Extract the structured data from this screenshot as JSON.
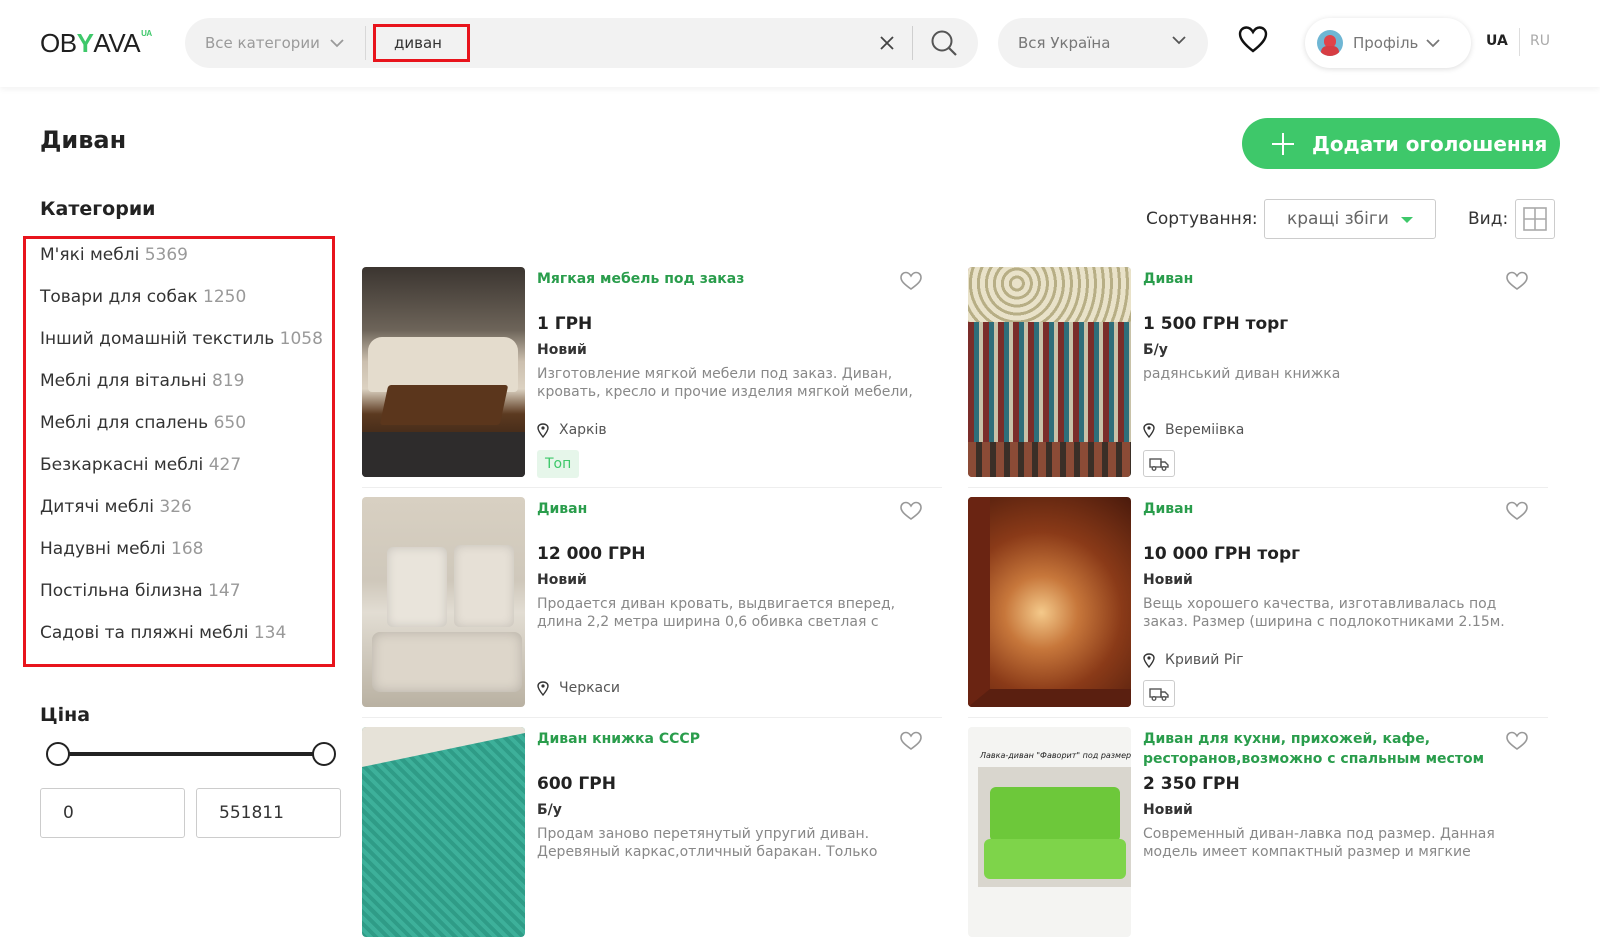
{
  "header": {
    "logo_text": "OBYAVA",
    "logo_sup": "UA",
    "category_select": "Все категории",
    "search_query": "диван",
    "region_select": "Вся Україна",
    "profile_label": "Профіль",
    "lang_active": "UA",
    "lang_other": "RU"
  },
  "page": {
    "title": "Диван",
    "add_button": "Додати оголошення"
  },
  "sidebar": {
    "categories_heading": "Категории",
    "categories": [
      {
        "name": "М'які меблі",
        "count": "5369"
      },
      {
        "name": "Товари для собак",
        "count": "1250"
      },
      {
        "name": "Інший домашній текстиль",
        "count": "1058"
      },
      {
        "name": "Меблі для вітальні",
        "count": "819"
      },
      {
        "name": "Меблі для спалень",
        "count": "650"
      },
      {
        "name": "Безкаркасні меблі",
        "count": "427"
      },
      {
        "name": "Дитячі меблі",
        "count": "326"
      },
      {
        "name": "Надувні меблі",
        "count": "168"
      },
      {
        "name": "Постільна білизна",
        "count": "147"
      },
      {
        "name": "Садові та пляжні меблі",
        "count": "134"
      }
    ],
    "price_heading": "Ціна",
    "price_from": "0",
    "price_to": "551811"
  },
  "sort": {
    "label": "Сортування:",
    "value": "кращі збіги",
    "view_label": "Вид:"
  },
  "listings": [
    {
      "title": "Мягкая мебель под заказ",
      "price": "1 ГРН",
      "condition": "Новий",
      "description": "Изготовление мягкой мебели под заказ. Диван, кровать, кресло и прочие изделия мягкой мебели,",
      "location": "Харків",
      "badge": "Топ"
    },
    {
      "title": "Диван",
      "price": "1 500 ГРН торг",
      "condition": "Б/у",
      "description": "радянський диван книжка",
      "location": "Вереміівка",
      "badge": ""
    },
    {
      "title": "Диван",
      "price": "12 000 ГРН",
      "condition": "Новий",
      "description": "Продается диван кровать, выдвигается вперед, длина 2,2 метра ширина 0,6 обивка светлая с",
      "location": "Черкаси",
      "badge": ""
    },
    {
      "title": "Диван",
      "price": "10 000 ГРН торг",
      "condition": "Новий",
      "description": "Вещь хорошего качества, изготавливалась под заказ. Размер (ширина с подлокотниками 2.15м.",
      "location": "Кривий Ріг",
      "badge": ""
    },
    {
      "title": "Диван книжка СССР",
      "price": "600 ГРН",
      "condition": "Б/у",
      "description": "Продам заново перетянутый упругий диван. Деревяный каркас,отличный баракан. Только",
      "location": "",
      "badge": ""
    },
    {
      "title": "Диван для кухни, прихожей, кафе, ресторанов,возможно с спальным местом",
      "price": "2 350 ГРН",
      "condition": "Новий",
      "description": "Современный диван-лавка под размер. Данная модель имеет компактный размер и мягкие",
      "location": "",
      "badge": ""
    }
  ],
  "thumb_caption": "Лавка-диван \"Фаворит\"  под размер"
}
